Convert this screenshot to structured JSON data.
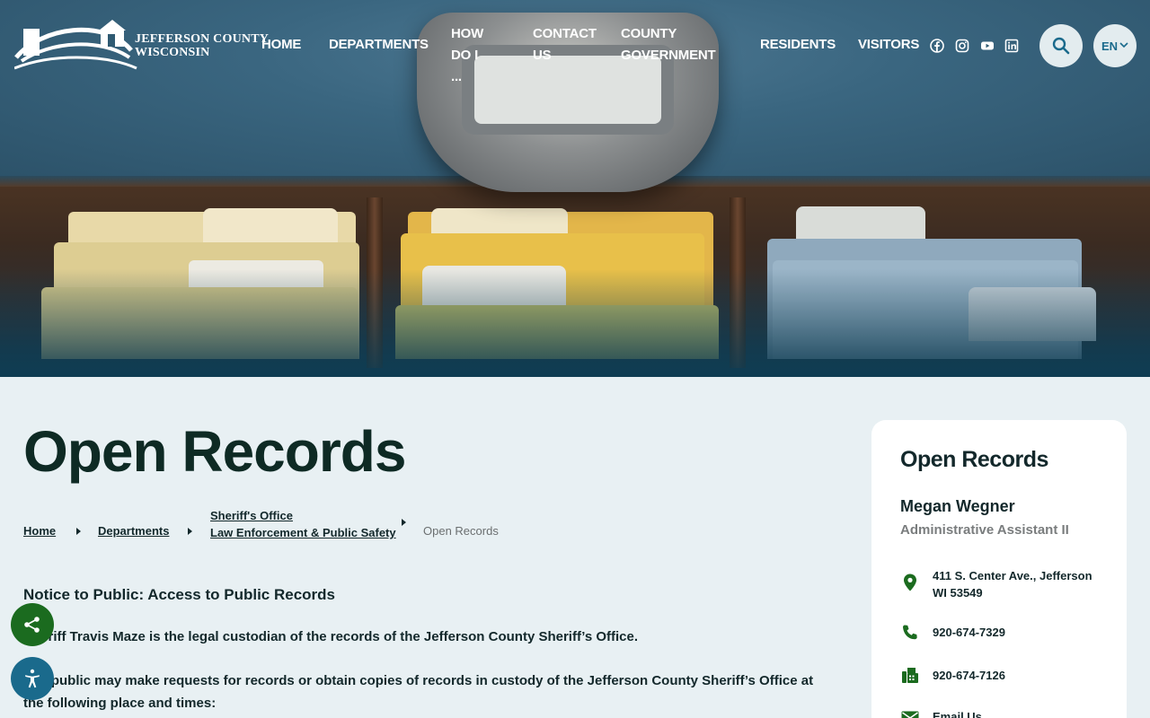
{
  "header": {
    "logo_text_line1": "JEFFERSON COUNTY",
    "logo_text_line2": "WISCONSIN",
    "nav": {
      "home": "HOME",
      "departments": "DEPARTMENTS",
      "how_do_i_line1": "HOW",
      "how_do_i_line2": "DO I ...",
      "contact_line1": "CONTACT",
      "contact_line2": "US",
      "county_line1": "COUNTY",
      "county_line2": "GOVERNMENT",
      "residents": "RESIDENTS",
      "visitors": "VISITORS"
    },
    "social_icons": [
      "facebook-icon",
      "instagram-icon",
      "youtube-icon",
      "linkedin-icon"
    ],
    "language": "EN"
  },
  "main": {
    "title": "Open Records",
    "breadcrumb": {
      "home": "Home",
      "departments": "Departments",
      "sheriff_line1": "Sheriff's Office",
      "sheriff_line2": "Law Enforcement & Public Safety",
      "current": "Open Records"
    },
    "notice_heading": "Notice to Public: Access to Public Records",
    "para1": "Sheriff Travis Maze is the legal custodian of the records of the Jefferson County Sheriff’s Office.",
    "para2": "The public may make requests for records or obtain copies of records in custody of the Jefferson County Sheriff’s Office at the following place and times:"
  },
  "sidebar": {
    "title": "Open Records",
    "contact_name": "Megan Wegner",
    "contact_role": "Administrative Assistant II",
    "address": "411 S. Center Ave.,  Jefferson WI 53549",
    "phone": "920-674-7329",
    "fax": "920-674-7126",
    "email_label": "Email Us"
  },
  "colors": {
    "accent_green": "#1b6b1f",
    "accent_blue": "#1a6a8c",
    "page_bg": "#e8f0f3"
  }
}
